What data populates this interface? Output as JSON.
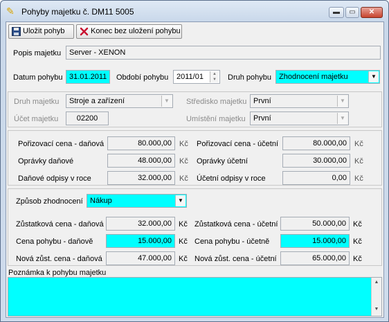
{
  "window": {
    "title": "Pohyby majetku č. DM11 5005"
  },
  "toolbar": {
    "save_label": "Uložit pohyb",
    "close_label": "Konec bez uložení pohybu"
  },
  "header": {
    "popis_label": "Popis majetku",
    "popis_value": "Server - XENON",
    "datum_label": "Datum pohybu",
    "datum_value": "31.01.2011",
    "obdobi_label": "Období pohybu",
    "obdobi_value": "2011/01",
    "druh_pohybu_label": "Druh pohybu",
    "druh_pohybu_value": "Zhodnocení majetku"
  },
  "asset": {
    "druh_label": "Druh majetku",
    "druh_value": "Stroje a zařízení",
    "ucet_label": "Účet majetku",
    "ucet_value": "02200",
    "stredisko_label": "Středisko majetku",
    "stredisko_value": "První",
    "umisteni_label": "Umístění majetku",
    "umisteni_value": "První"
  },
  "values": {
    "porizovaci_danova_label": "Pořizovací cena - daňová",
    "porizovaci_danova": "80.000,00",
    "opravky_danove_label": "Oprávky daňové",
    "opravky_danove": "48.000,00",
    "danove_odpisy_label": "Daňové odpisy v roce",
    "danove_odpisy": "32.000,00",
    "porizovaci_ucetni_label": "Pořizovací cena - účetní",
    "porizovaci_ucetni": "80.000,00",
    "opravky_ucetni_label": "Oprávky účetní",
    "opravky_ucetni": "30.000,00",
    "ucetni_odpisy_label": "Účetní odpisy v roce",
    "ucetni_odpisy": "0,00",
    "unit": "Kč"
  },
  "movement": {
    "zpusob_label": "Způsob zhodnocení",
    "zpusob_value": "Nákup",
    "zustatkova_danova_label": "Zůstatková cena - daňová",
    "zustatkova_danova": "32.000,00",
    "cena_danove_label": "Cena pohybu - daňově",
    "cena_danove": "15.000,00",
    "nova_danova_label": "Nová zůst. cena - daňová",
    "nova_danova": "47.000,00",
    "zustatkova_ucetni_label": "Zůstatková cena - účetní",
    "zustatkova_ucetni": "50.000,00",
    "cena_ucetne_label": "Cena pohybu - účetně",
    "cena_ucetne": "15.000,00",
    "nova_ucetni_label": "Nová zůst. cena - účetní",
    "nova_ucetni": "65.000,00"
  },
  "note": {
    "label": "Poznámka k pohybu majetku",
    "value": ""
  },
  "colors": {
    "highlight": "#00ffff"
  }
}
